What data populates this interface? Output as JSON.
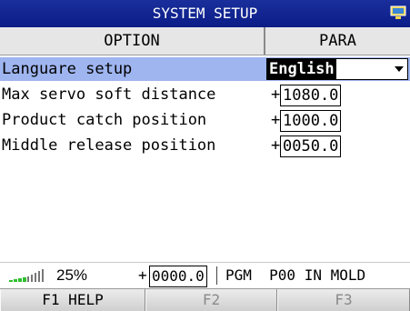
{
  "title": "SYSTEM SETUP",
  "header": {
    "option": "OPTION",
    "para": "PARA"
  },
  "rows": [
    {
      "label": "Languare setup",
      "value": "English"
    },
    {
      "label": "Max servo soft distance",
      "sign": "+",
      "value": "1080.0"
    },
    {
      "label": "Product catch position",
      "sign": "+",
      "value": "1000.0"
    },
    {
      "label": "Middle release position",
      "sign": "+",
      "value": "0050.0"
    }
  ],
  "status": {
    "percent": "25%",
    "sign": "+",
    "value": "0000.0",
    "program": "PGM  P00 IN MOLD"
  },
  "fkeys": [
    {
      "label": "F1 HELP",
      "enabled": true
    },
    {
      "label": "F2",
      "enabled": false
    },
    {
      "label": "F3",
      "enabled": false
    }
  ],
  "icons": {
    "title": "monitor-icon",
    "dropdown": "dropdown-arrow-icon",
    "signal": "signal-strength-icon"
  },
  "colors": {
    "titlebar": "#0b1c86",
    "selected_row": "#9fb5f0",
    "header_bg": "#e6e6e6"
  }
}
